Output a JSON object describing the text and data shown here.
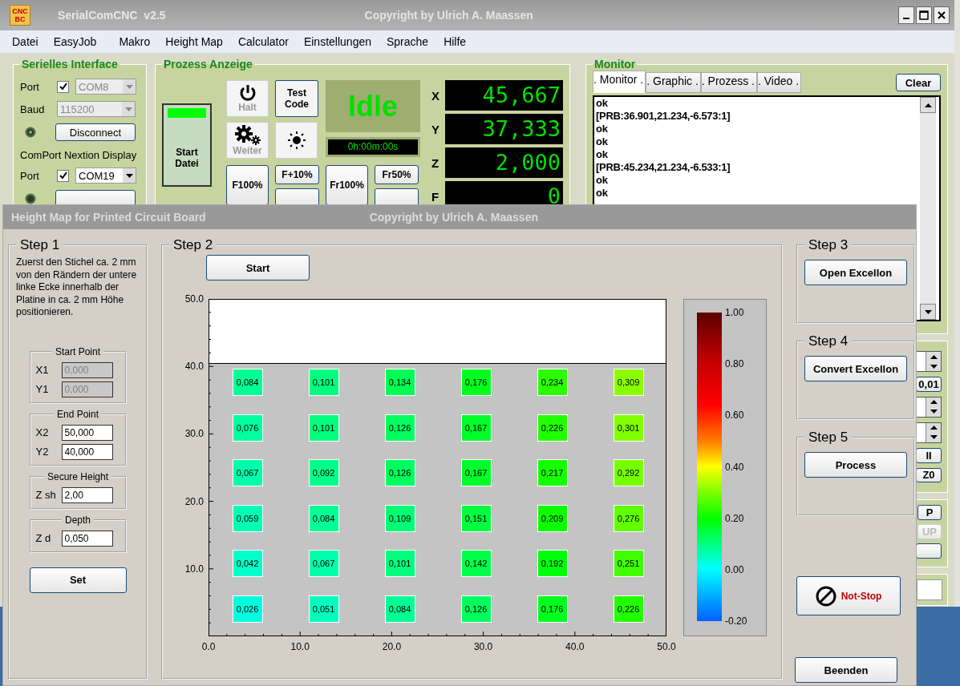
{
  "window": {
    "logo": [
      "CNC",
      "BC"
    ],
    "title": "SerialComCNC  v2.5",
    "copyright": "Copyright by Ulrich A. Maassen"
  },
  "menu": [
    "Datei",
    "EasyJob",
    "Makro",
    "Height Map",
    "Calculator",
    "Einstellungen",
    "Sprache",
    "Hilfe"
  ],
  "serial": {
    "title": "Serielles Interface",
    "port_label": "Port",
    "port_checked": true,
    "port": "COM8",
    "baud_label": "Baud",
    "baud": "115200",
    "disconnect": "Disconnect",
    "nextion_title": "ComPort Nextion Display",
    "nextion_port_label": "Port",
    "nextion_checked": true,
    "nextion_port": "COM19"
  },
  "process": {
    "title": "Prozess Anzeige",
    "start": "Start Datei",
    "halt": {
      "label": "Halt",
      "disabled": true
    },
    "weiter": {
      "label": "Weiter",
      "disabled": true
    },
    "test_code": "Test Code",
    "status": "Idle",
    "timer": "0h:00m:00s",
    "feed": [
      "F100%",
      "F+10%"
    ],
    "rapid": [
      "Fr100%",
      "Fr50%"
    ],
    "axes": [
      {
        "label": "X",
        "value": "45,667"
      },
      {
        "label": "Y",
        "value": "37,333"
      },
      {
        "label": "Z",
        "value": "2,000"
      },
      {
        "label": "F",
        "value": "0"
      }
    ]
  },
  "monitor": {
    "title": "Monitor",
    "tabs": [
      {
        "label": ". Monitor .",
        "selected": true
      },
      {
        "label": ". Graphic .",
        "selected": false
      },
      {
        "label": ". Prozess .",
        "selected": false
      },
      {
        "label": ". Video .",
        "selected": false
      }
    ],
    "clear": "Clear",
    "lines": [
      "ok",
      "[PRB:36.901,21.234,-6.573:1]",
      "ok",
      "ok",
      "ok",
      "[PRB:45.234,21.234,-6.533:1]",
      "ok",
      "ok"
    ]
  },
  "side_controls": {
    "step_button": "0,01",
    "pause_button": "II",
    "zero_button": "Z0",
    "p_button": "P",
    "up_button": {
      "label": "UP",
      "disabled": true
    }
  },
  "dialog": {
    "title": "Height Map for Printed Circuit Board",
    "copyright": "Copyright by Ulrich A. Maassen",
    "step1": {
      "title": "Step 1",
      "text": "Zuerst den Stichel ca. 2 mm von den Rändern der untere linke Ecke innerhalb der Platine in ca. 2 mm Höhe positionieren.",
      "groups": [
        {
          "title": "Start Point",
          "fields": [
            {
              "label": "X1",
              "value": "0,000",
              "disabled": true
            },
            {
              "label": "Y1",
              "value": "0,000",
              "disabled": true
            }
          ]
        },
        {
          "title": "End Point",
          "fields": [
            {
              "label": "X2",
              "value": "50,000",
              "disabled": false
            },
            {
              "label": "Y2",
              "value": "40,000",
              "disabled": false
            }
          ]
        },
        {
          "title": "Secure Height",
          "fields": [
            {
              "label": "Z sh",
              "value": "2,00",
              "disabled": false
            }
          ]
        },
        {
          "title": "Depth",
          "fields": [
            {
              "label": "Z d",
              "value": "0,050",
              "disabled": false
            }
          ]
        }
      ],
      "set": "Set"
    },
    "step2": {
      "title": "Step 2",
      "start": "Start",
      "y_ticks": [
        "50.0",
        "40.0",
        "30.0",
        "20.0",
        "10.0"
      ],
      "x_ticks": [
        "0.0",
        "10.0",
        "20.0",
        "30.0",
        "40.0",
        "50.0"
      ],
      "cells": [
        [
          {
            "value": "0,084",
            "color": "#00ff94"
          },
          {
            "value": "0,101",
            "color": "#00ff7e"
          },
          {
            "value": "0,134",
            "color": "#00ff54"
          },
          {
            "value": "0,176",
            "color": "#00ff1f"
          },
          {
            "value": "0,234",
            "color": "#2bff00"
          },
          {
            "value": "0,309",
            "color": "#8bff00"
          }
        ],
        [
          {
            "value": "0,076",
            "color": "#00ff9e"
          },
          {
            "value": "0,101",
            "color": "#00ff7e"
          },
          {
            "value": "0,126",
            "color": "#00ff5e"
          },
          {
            "value": "0,167",
            "color": "#00ff2a"
          },
          {
            "value": "0,226",
            "color": "#21ff00"
          },
          {
            "value": "0,301",
            "color": "#81ff00"
          }
        ],
        [
          {
            "value": "0,067",
            "color": "#00ffaa"
          },
          {
            "value": "0,092",
            "color": "#00ff8a"
          },
          {
            "value": "0,126",
            "color": "#00ff5e"
          },
          {
            "value": "0,167",
            "color": "#00ff2a"
          },
          {
            "value": "0,217",
            "color": "#16ff00"
          },
          {
            "value": "0,292",
            "color": "#75ff00"
          }
        ],
        [
          {
            "value": "0,059",
            "color": "#00ffb4"
          },
          {
            "value": "0,084",
            "color": "#00ff94"
          },
          {
            "value": "0,109",
            "color": "#00ff74"
          },
          {
            "value": "0,151",
            "color": "#00ff3e"
          },
          {
            "value": "0,209",
            "color": "#0bff00"
          },
          {
            "value": "0,276",
            "color": "#61ff00"
          }
        ],
        [
          {
            "value": "0,042",
            "color": "#00ffc9"
          },
          {
            "value": "0,067",
            "color": "#00ffaa"
          },
          {
            "value": "0,101",
            "color": "#00ff7e"
          },
          {
            "value": "0,142",
            "color": "#00ff4a"
          },
          {
            "value": "0,192",
            "color": "#00ff0a"
          },
          {
            "value": "0,251",
            "color": "#41ff00"
          }
        ],
        [
          {
            "value": "0,026",
            "color": "#00ffde"
          },
          {
            "value": "0,051",
            "color": "#00ffbe"
          },
          {
            "value": "0,084",
            "color": "#00ff94"
          },
          {
            "value": "0,126",
            "color": "#00ff5e"
          },
          {
            "value": "0,176",
            "color": "#00ff1f"
          },
          {
            "value": "0,226",
            "color": "#21ff00"
          }
        ]
      ],
      "scale": [
        "1.00",
        "0.80",
        "0.60",
        "0.40",
        "0.20",
        "0.00",
        "-0.20"
      ]
    },
    "step3": {
      "title": "Step 3",
      "button": "Open Excellon"
    },
    "step4": {
      "title": "Step 4",
      "button": "Convert Excellon"
    },
    "step5": {
      "title": "Step 5",
      "button": "Process"
    },
    "not_stop": "Not-Stop",
    "close": "Beenden"
  }
}
